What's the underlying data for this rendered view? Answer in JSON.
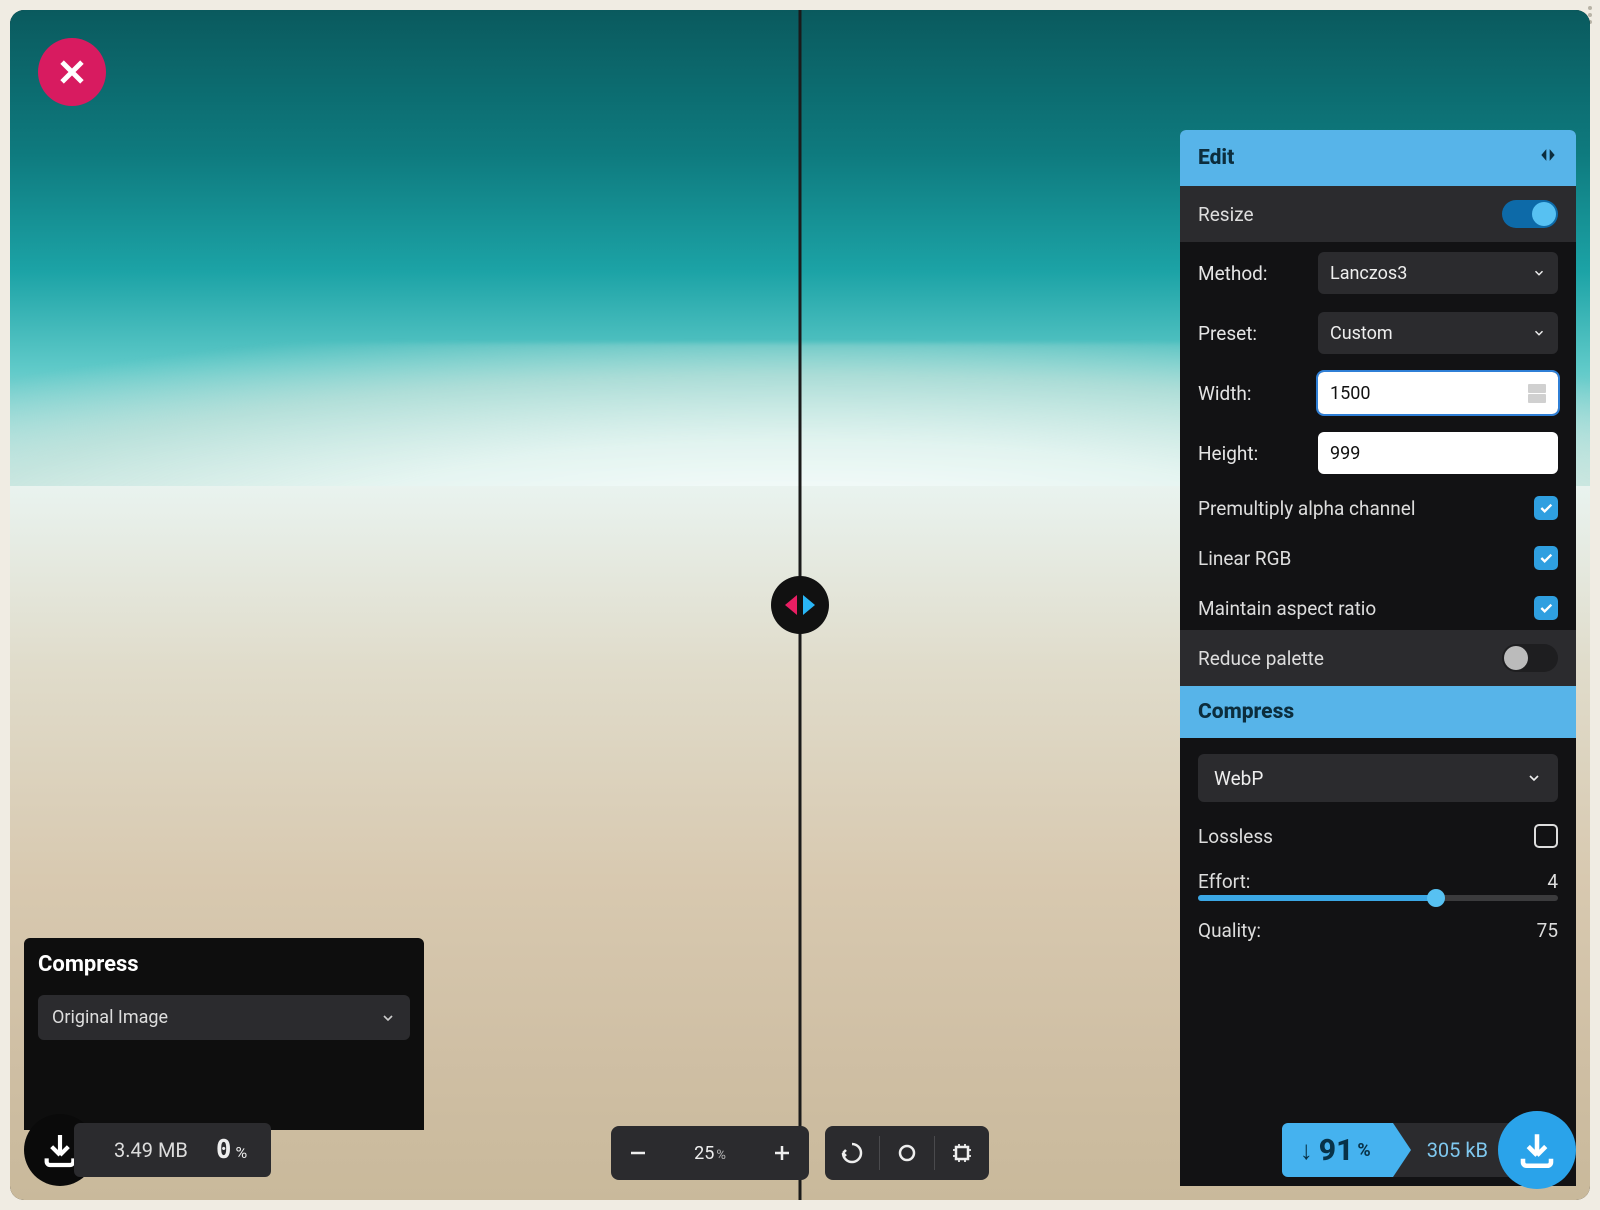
{
  "close_tooltip": "Close",
  "left_panel": {
    "title": "Compress",
    "source_select": "Original Image",
    "size_value": "3.49",
    "size_unit": "MB",
    "delta_value": "0",
    "delta_unit": "%"
  },
  "toolbar": {
    "zoom_value": "25",
    "zoom_unit": "%"
  },
  "sidebar": {
    "header": "Edit",
    "resize": {
      "label": "Resize",
      "enabled": true,
      "method_label": "Method:",
      "method_value": "Lanczos3",
      "preset_label": "Preset:",
      "preset_value": "Custom",
      "width_label": "Width:",
      "width_value": "1500",
      "height_label": "Height:",
      "height_value": "999",
      "premultiply_label": "Premultiply alpha channel",
      "premultiply": true,
      "linear_rgb_label": "Linear RGB",
      "linear_rgb": true,
      "aspect_label": "Maintain aspect ratio",
      "aspect": true
    },
    "reduce_palette": {
      "label": "Reduce palette",
      "enabled": false
    },
    "compress": {
      "title": "Compress",
      "format": "WebP",
      "lossless_label": "Lossless",
      "lossless": false,
      "effort_label": "Effort:",
      "effort_value": "4",
      "effort_pct": 66,
      "quality_label": "Quality:",
      "quality_value": "75"
    }
  },
  "right_footer": {
    "savings_value": "91",
    "savings_unit": "%",
    "out_size_value": "305",
    "out_size_unit": "kB"
  }
}
